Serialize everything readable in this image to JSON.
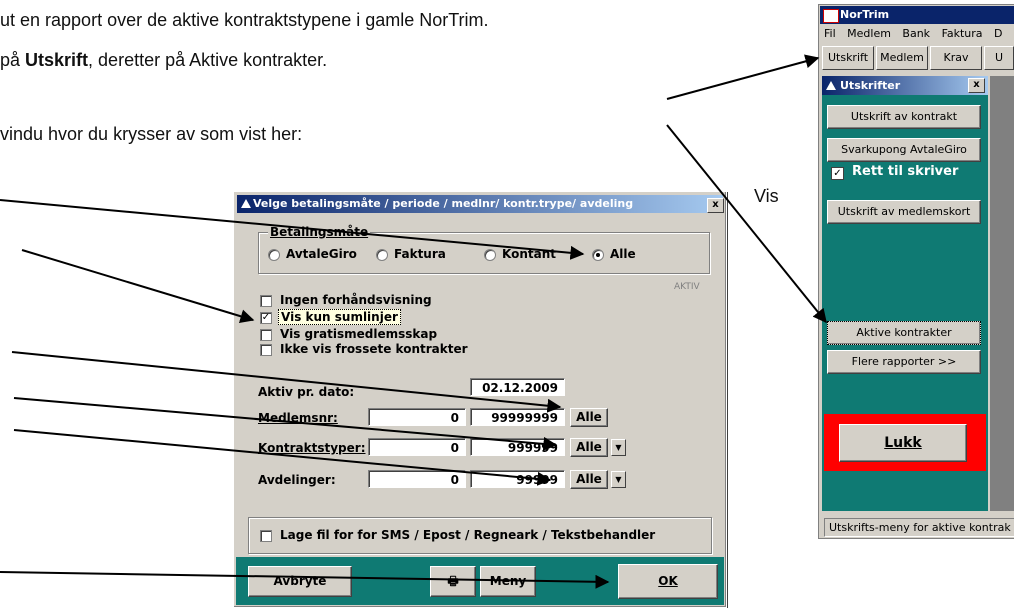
{
  "doc": {
    "line1": "ut en rapport over de aktive kontraktstypene i gamle NorTrim.",
    "line2_prefix": "på ",
    "line2_bold": "Utskrift",
    "line2_suffix": ", deretter på Aktive kontrakter.",
    "line3": "vindu hvor du krysser av som vist her:",
    "vis_label": "Vis"
  },
  "dialog": {
    "title": "Velge betalingsmåte / periode / medlnr/ kontr.trype/ avdeling",
    "close": "x",
    "payment_group_label": "Betalingsmåte",
    "payment_options": [
      "AvtaleGiro",
      "Faktura",
      "Kontant",
      "Alle"
    ],
    "payment_selected": "Alle",
    "aktiv_label": "AKTIV",
    "checkboxes": [
      {
        "label": "Ingen forhåndsvisning",
        "checked": false
      },
      {
        "label": "Vis kun sumlinjer",
        "checked": true
      },
      {
        "label": "Vis gratismedlemsskap",
        "checked": false
      },
      {
        "label": "Ikke vis frossete kontrakter",
        "checked": false
      }
    ],
    "aktiv_date_label": "Aktiv pr. dato:",
    "aktiv_date": "02.12.2009",
    "medlemsnr_label": "Medlemsnr:",
    "medlemsnr_from": "0",
    "medlemsnr_to": "99999999",
    "kontraktstyper_label": "Kontraktstyper:",
    "kontraktstyper_from": "0",
    "kontraktstyper_to": "999999",
    "avdelinger_label": "Avdelinger:",
    "avdelinger_from": "0",
    "avdelinger_to": "99999",
    "alle_label": "Alle",
    "dropdown_glyph": "▼",
    "file_checkbox_label": "Lage fil for  for SMS / Epost / Regneark / Tekstbehandler",
    "cancel_label": "Avbryte",
    "print_glyph": "🖶",
    "menu_label": "Meny",
    "ok_label": "OK"
  },
  "nortrim": {
    "title": "NorTrim",
    "menu": [
      "Fil",
      "Medlem",
      "Bank",
      "Faktura",
      "D"
    ],
    "toolbar": [
      "Utskrift",
      "Medlem",
      "Krav",
      "U"
    ],
    "pane_title": "Utskrifter",
    "pane_close": "x",
    "buttons": {
      "kontrakt": "Utskrift av kontrakt",
      "svarkupong": "Svarkupong AvtaleGiro",
      "rett_til_skriver": "Rett til skriver",
      "medlemskort": "Utskrift av medlemskort",
      "aktive": "Aktive kontrakter",
      "flere": "Flere rapporter >>",
      "lukk": "Lukk"
    },
    "status": "Utskrifts-meny for aktive kontrak",
    "colors": {
      "pane": "#0f7a73",
      "lukk_frame": "#ff0000",
      "titlebar": "#0a246a"
    }
  }
}
